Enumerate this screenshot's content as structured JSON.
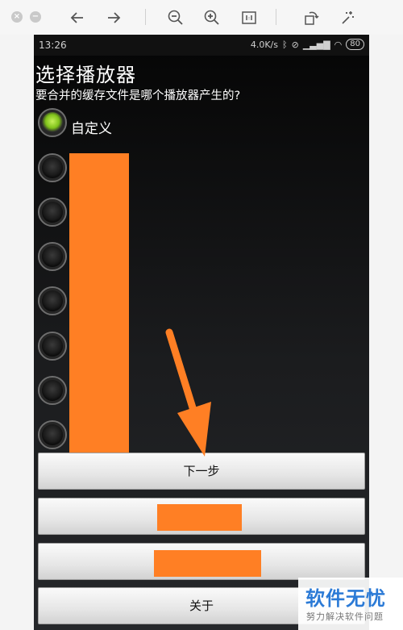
{
  "toolbar": {
    "close_glyph": "×",
    "min_glyph": "−",
    "buttons": [
      "back-arrow-icon",
      "forward-arrow-icon",
      "zoom-out-icon",
      "zoom-in-icon",
      "actual-size-icon",
      "rotate-icon",
      "magic-wand-icon"
    ]
  },
  "statusbar": {
    "time": "13:26",
    "speed": "4.0K/s",
    "battery": "80"
  },
  "dialog": {
    "title": "选择播放器",
    "subtitle": "要合并的缓存文件是哪个播放器产生的?",
    "options": [
      {
        "label": "自定义",
        "checked": true
      },
      {
        "label": "",
        "checked": false
      },
      {
        "label": "",
        "checked": false
      },
      {
        "label": "",
        "checked": false
      },
      {
        "label": "",
        "checked": false
      },
      {
        "label": "",
        "checked": false
      },
      {
        "label": "",
        "checked": false
      },
      {
        "label": "",
        "checked": false
      }
    ]
  },
  "buttons": {
    "next": "下一步",
    "about": "关于"
  },
  "annotation": {
    "arrow_color": "#ff7f24",
    "redaction_color": "#ff7f24"
  },
  "watermark": {
    "logo": "软件无忧",
    "sub": "努力解决软件问题"
  }
}
